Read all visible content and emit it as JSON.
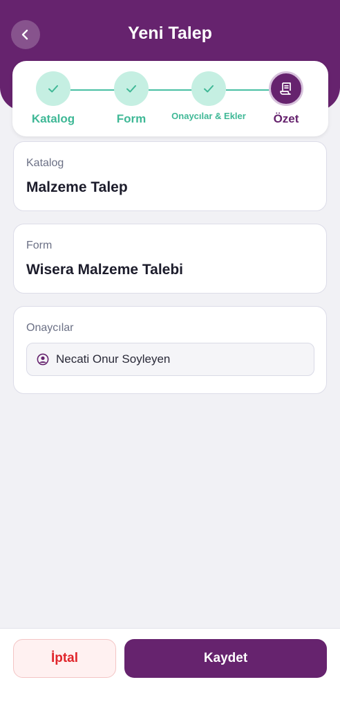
{
  "header": {
    "title": "Yeni Talep",
    "back_icon": "chevron-left-icon"
  },
  "stepper": {
    "steps": [
      {
        "label": "Katalog",
        "status": "done",
        "icon": "check-icon"
      },
      {
        "label": "Form",
        "status": "done",
        "icon": "check-icon"
      },
      {
        "label": "Onaycılar & Ekler",
        "status": "done",
        "icon": "check-icon"
      },
      {
        "label": "Özet",
        "status": "active",
        "icon": "document-icon"
      }
    ]
  },
  "summary": {
    "catalog": {
      "label": "Katalog",
      "value": "Malzeme Talep"
    },
    "form": {
      "label": "Form",
      "value": "Wisera Malzeme Talebi"
    },
    "approvers": {
      "label": "Onaycılar",
      "items": [
        "Necati Onur Soyleyen"
      ]
    }
  },
  "footer": {
    "cancel_label": "İptal",
    "save_label": "Kaydet"
  },
  "colors": {
    "brand": "#66236e",
    "success": "#48bfa3",
    "danger": "#e0252b"
  }
}
